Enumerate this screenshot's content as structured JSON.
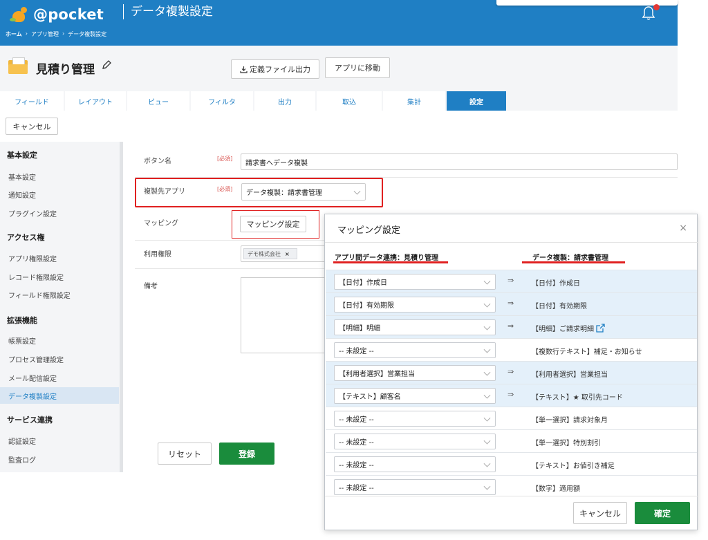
{
  "header": {
    "logo_text": "@pocket",
    "title": "データ複製設定",
    "breadcrumb": [
      "ホーム",
      "›",
      "アプリ管理",
      "›",
      "データ複製設定"
    ]
  },
  "app": {
    "name": "見積り管理",
    "export_label": "定義ファイル出力",
    "goto_label": "アプリに移動"
  },
  "tabs": [
    "フィールド",
    "レイアウト",
    "ビュー",
    "フィルタ",
    "出力",
    "取込",
    "集計",
    "設定"
  ],
  "active_tab": "設定",
  "cancel_label": "キャンセル",
  "sidebar": {
    "sections": [
      {
        "title": "基本設定",
        "items": [
          "基本設定",
          "通知設定",
          "プラグイン設定"
        ]
      },
      {
        "title": "アクセス権",
        "items": [
          "アプリ権限設定",
          "レコード権限設定",
          "フィールド権限設定"
        ]
      },
      {
        "title": "拡張機能",
        "items": [
          "帳票設定",
          "プロセス管理設定",
          "メール配信設定",
          "データ複製設定"
        ]
      },
      {
        "title": "サービス連携",
        "items": [
          "認証設定",
          "監査ログ"
        ]
      }
    ],
    "active_item": "データ複製設定"
  },
  "form": {
    "required_label": "[必須]",
    "button_name_label": "ボタン名",
    "button_name_value": "請求書へデータ複製",
    "target_app_label": "複製先アプリ",
    "target_app_value": "データ複製：請求書管理",
    "mapping_label": "マッピング",
    "mapping_button": "マッピング設定",
    "permission_label": "利用権限",
    "permission_tag": "デモ株式会社",
    "permission_tag_remove": "×",
    "note_label": "備考",
    "reset_label": "リセット",
    "submit_label": "登録"
  },
  "modal": {
    "title": "マッピング設定",
    "close": "×",
    "left_header": "アプリ間データ連携：見積り管理",
    "right_header": "データ複製：請求書管理",
    "arrow": "⇒",
    "rows": [
      {
        "source": "【日付】作成日",
        "target": "【日付】作成日",
        "linked": true
      },
      {
        "source": "【日付】有効期限",
        "target": "【日付】有効期限",
        "linked": true
      },
      {
        "source": "【明細】明細",
        "target": "【明細】ご請求明細",
        "linked": true,
        "external_link": true
      },
      {
        "source": "-- 未設定 --",
        "target": "【複数行テキスト】補足・お知らせ",
        "linked": false
      },
      {
        "source": "【利用者選択】営業担当",
        "target": "【利用者選択】営業担当",
        "linked": true
      },
      {
        "source": "【テキスト】顧客名",
        "target": "【テキスト】★ 取引先コード",
        "linked": true
      },
      {
        "source": "-- 未設定 --",
        "target": "【単一選択】請求対象月",
        "linked": false
      },
      {
        "source": "-- 未設定 --",
        "target": "【単一選択】特別割引",
        "linked": false
      },
      {
        "source": "-- 未設定 --",
        "target": "【テキスト】お値引き補足",
        "linked": false
      },
      {
        "source": "-- 未設定 --",
        "target": "【数字】適用額",
        "linked": false
      }
    ],
    "cancel_label": "キャンセル",
    "confirm_label": "確定"
  },
  "colors": {
    "brand_blue": "#1f7fc4",
    "confirm_green": "#1a8c3c",
    "highlight_red": "#e02020",
    "linked_row_bg": "#e4f0fa"
  }
}
